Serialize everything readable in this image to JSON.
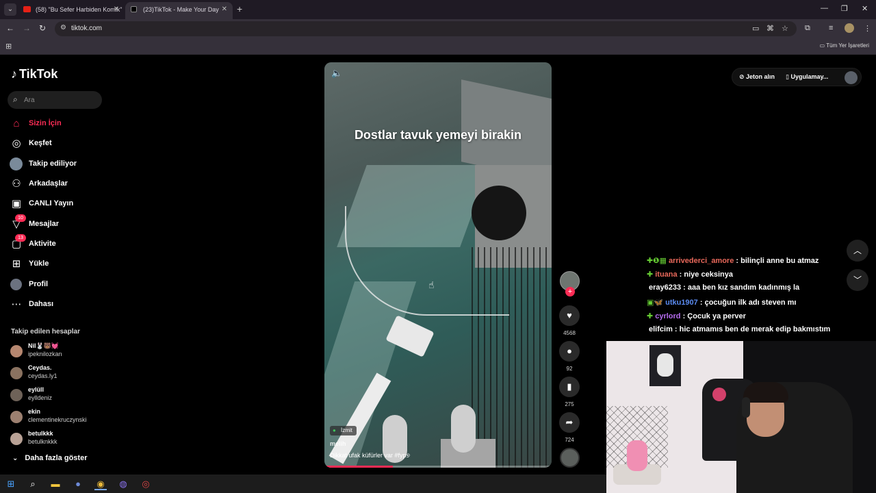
{
  "browser": {
    "tabs": [
      {
        "title": "(58) \"Bu Sefer Harbiden Komik\"",
        "active": false
      },
      {
        "title": "(23)TikTok - Make Your Day",
        "active": true
      }
    ],
    "url": "tiktok.com",
    "bookmarks_all": "Tüm Yer İşaretleri"
  },
  "tiktok": {
    "brand": "TikTok",
    "search_placeholder": "Ara",
    "nav": [
      {
        "label": "Sizin İçin",
        "icon": "home-icon",
        "active": true
      },
      {
        "label": "Keşfet",
        "icon": "compass-icon"
      },
      {
        "label": "Takip ediliyor",
        "icon": "following-avatar-icon"
      },
      {
        "label": "Arkadaşlar",
        "icon": "friends-icon"
      },
      {
        "label": "CANLI Yayın",
        "icon": "live-tv-icon"
      },
      {
        "label": "Mesajlar",
        "icon": "messages-icon",
        "badge": "10"
      },
      {
        "label": "Aktivite",
        "icon": "activity-icon",
        "badge": "13"
      },
      {
        "label": "Yükle",
        "icon": "upload-icon"
      },
      {
        "label": "Profil",
        "icon": "profile-icon"
      },
      {
        "label": "Dahası",
        "icon": "more-dots-icon"
      }
    ],
    "following_title": "Takip edilen hesaplar",
    "following": [
      {
        "name": "Nil🐰🐻💓",
        "username": "ipeknilozkan"
      },
      {
        "name": "Ceydas.",
        "username": "ceydas.ly1"
      },
      {
        "name": "eylüll",
        "username": "eylldeniz"
      },
      {
        "name": "ekin",
        "username": "clementinekruczynski"
      },
      {
        "name": "betulkkk",
        "username": "betulknkkk"
      }
    ],
    "show_more": "Daha fazla göster",
    "video": {
      "caption": "Dostlar tavuk yemeyi birakin",
      "location": "İzmit",
      "author": "melih",
      "description": "Dikkat ufak küfürler var #fyp୭",
      "progress": 0.3
    },
    "actions": {
      "likes": "4568",
      "comments": "92",
      "saves": "275",
      "shares": "724"
    },
    "top_right": {
      "coins": "Jeton alın",
      "app": "Uygulamay..."
    }
  },
  "chat": [
    {
      "badges": "✚❶▦",
      "user": "arrivederci_amore",
      "color": "#e8685a",
      "message": "bilinçli anne bu atmaz"
    },
    {
      "badges": "✚",
      "user": "ituana",
      "color": "#e8685a",
      "message": "niye ceksinya"
    },
    {
      "badges": "",
      "user": "eray6233",
      "color": "#ffffff",
      "message": "aaa ben kız sandım kadınmış la"
    },
    {
      "badges": "▣🦋",
      "user": "utku1907",
      "color": "#5b8cf2",
      "message": "çocuğun ilk adı steven mı"
    },
    {
      "badges": "✚",
      "user": "cyrlord",
      "color": "#b66cf0",
      "message": "Çocuk ya perver"
    },
    {
      "badges": "",
      "user": "elifcim",
      "color": "#ffffff",
      "message": "hic atmamıs ben de merak edip bakmıstım"
    }
  ]
}
